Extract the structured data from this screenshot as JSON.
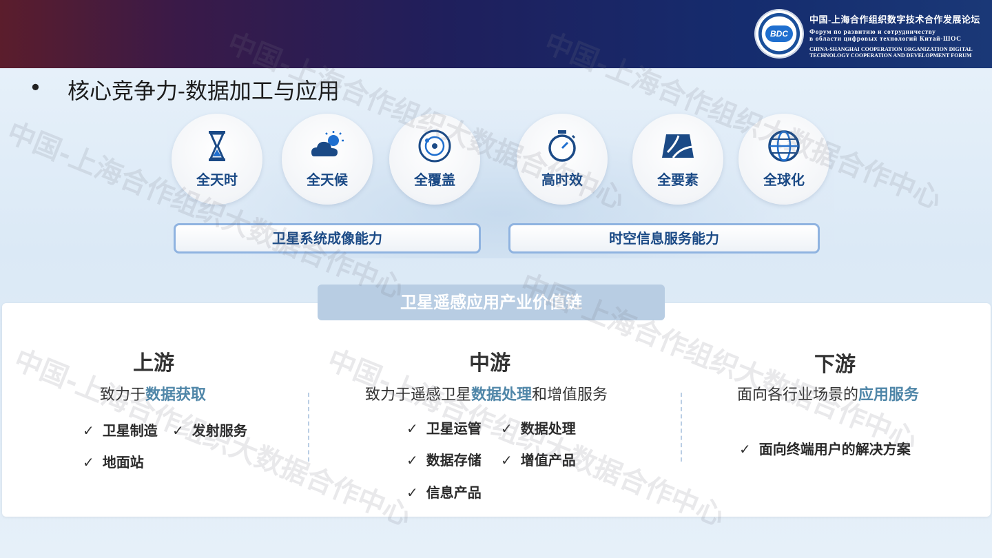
{
  "header": {
    "org_cn": "中国-上海合作组织数字技术合作发展论坛",
    "org_ru_1": "Форум по развитию и сотрудничеству",
    "org_ru_2": "в области цифровых технологий Китай-ШОС",
    "org_en_1": "CHINA-SHANGHAI COOPERATION ORGANIZATION DIGITAL",
    "org_en_2": "TECHNOLOGY COOPERATION AND DEVELOPMENT FORUM",
    "logo_text": "BDC"
  },
  "watermark": "中国-上海合作组织大数据合作中心",
  "slide": {
    "bullet": "•",
    "title": "核心竞争力-数据加工与应用"
  },
  "capabilities": [
    {
      "label": "全天时",
      "icon": "hourglass-icon"
    },
    {
      "label": "全天候",
      "icon": "weather-icon"
    },
    {
      "label": "全覆盖",
      "icon": "orbit-icon"
    },
    {
      "label": "高时效",
      "icon": "stopwatch-icon"
    },
    {
      "label": "全要素",
      "icon": "map-icon"
    },
    {
      "label": "全球化",
      "icon": "globe-icon"
    }
  ],
  "capability_groups": {
    "left": "卫星系统成像能力",
    "right": "时空信息服务能力"
  },
  "value_chain": {
    "title": "卫星遥感应用产业价值链",
    "upstream": {
      "heading": "上游",
      "sub_pre": "致力于",
      "sub_hl": "数据获取",
      "sub_post": "",
      "items": [
        "卫星制造",
        "发射服务",
        "地面站"
      ]
    },
    "midstream": {
      "heading": "中游",
      "sub_pre": "致力于遥感卫星",
      "sub_hl": "数据处理",
      "sub_post": "和增值服务",
      "items": [
        "卫星运管",
        "数据处理",
        "数据存储",
        "增值产品",
        "信息产品"
      ]
    },
    "downstream": {
      "heading": "下游",
      "sub_pre": "面向各行业场景的",
      "sub_hl": "应用服务",
      "sub_post": "",
      "items": [
        "面向终端用户的解决方案"
      ]
    },
    "tick": "✓"
  },
  "colors": {
    "accent_blue": "#1b4a86",
    "highlight_teal": "#4f86a8",
    "chain_banner": "#b8cde3",
    "box_border": "#8fb3e0"
  }
}
